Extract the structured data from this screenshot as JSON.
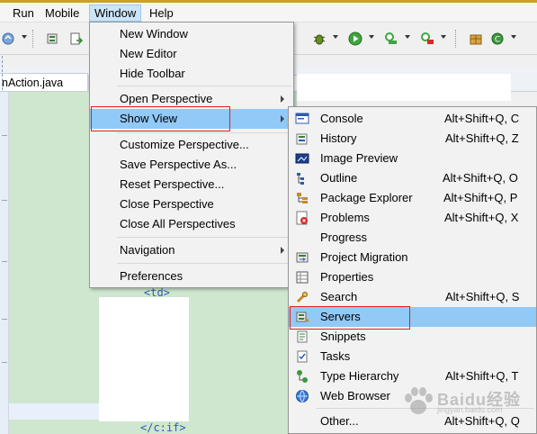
{
  "menubar": {
    "items": [
      {
        "label": "Run"
      },
      {
        "label": "Mobile"
      },
      {
        "label": "Window"
      },
      {
        "label": "Help"
      }
    ]
  },
  "editor": {
    "tab_label": "nAction.java",
    "code_lines": [
      "<td>",
      "</c:if>"
    ]
  },
  "window_menu": {
    "items": [
      {
        "label": "New Window"
      },
      {
        "label": "New Editor"
      },
      {
        "label": "Hide Toolbar"
      },
      {
        "label": "Open Perspective"
      },
      {
        "label": "Show View"
      },
      {
        "label": "Customize Perspective..."
      },
      {
        "label": "Save Perspective As..."
      },
      {
        "label": "Reset Perspective..."
      },
      {
        "label": "Close Perspective"
      },
      {
        "label": "Close All Perspectives"
      },
      {
        "label": "Navigation"
      },
      {
        "label": "Preferences"
      }
    ]
  },
  "show_view_menu": {
    "items": [
      {
        "label": "Console",
        "shortcut": "Alt+Shift+Q, C",
        "icon": "console-icon"
      },
      {
        "label": "History",
        "shortcut": "Alt+Shift+Q, Z",
        "icon": "history-icon"
      },
      {
        "label": "Image Preview",
        "shortcut": "",
        "icon": "image-preview-icon"
      },
      {
        "label": "Outline",
        "shortcut": "Alt+Shift+Q, O",
        "icon": "outline-icon"
      },
      {
        "label": "Package Explorer",
        "shortcut": "Alt+Shift+Q, P",
        "icon": "package-explorer-icon"
      },
      {
        "label": "Problems",
        "shortcut": "Alt+Shift+Q, X",
        "icon": "problems-icon"
      },
      {
        "label": "Progress",
        "shortcut": "",
        "icon": "progress-icon"
      },
      {
        "label": "Project Migration",
        "shortcut": "",
        "icon": "project-migration-icon"
      },
      {
        "label": "Properties",
        "shortcut": "",
        "icon": "properties-icon"
      },
      {
        "label": "Search",
        "shortcut": "Alt+Shift+Q, S",
        "icon": "search-icon"
      },
      {
        "label": "Servers",
        "shortcut": "",
        "icon": "servers-icon"
      },
      {
        "label": "Snippets",
        "shortcut": "",
        "icon": "snippets-icon"
      },
      {
        "label": "Tasks",
        "shortcut": "",
        "icon": "tasks-icon"
      },
      {
        "label": "Type Hierarchy",
        "shortcut": "Alt+Shift+Q, T",
        "icon": "type-hierarchy-icon"
      },
      {
        "label": "Web Browser",
        "shortcut": "",
        "icon": "web-browser-icon"
      },
      {
        "label": "Other...",
        "shortcut": "Alt+Shift+Q, Q",
        "icon": ""
      }
    ]
  },
  "watermark": {
    "text": "Baidu经验",
    "sub": "jingyan.baidu.com"
  },
  "colors": {
    "highlight": "#91c9f7",
    "menu_bg": "#f2f2f2",
    "annotation_box": "#e02020",
    "editor_bg": "#cfe6cf",
    "top_strip": "#c9a227"
  }
}
